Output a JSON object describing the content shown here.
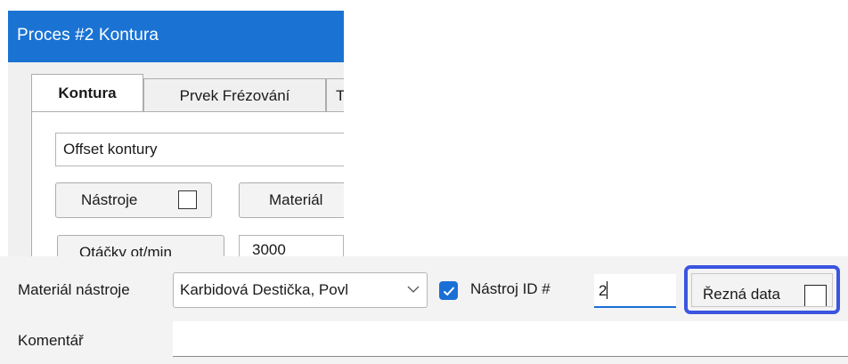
{
  "dialog": {
    "title": "Proces #2 Kontura",
    "tabs": [
      {
        "label": "Kontura",
        "active": true
      },
      {
        "label": "Prvek Frézování",
        "active": false
      },
      {
        "label": "T",
        "active": false
      }
    ],
    "operation_field": "Offset kontury",
    "tools_button": "Nástroje",
    "material_button": "Materiál",
    "rpm_button": "Otáčky ot/min",
    "rpm_value": "3000"
  },
  "strip": {
    "tool_material_label": "Materiál nástroje",
    "tool_material_value": "Karbidová Destička, Povl",
    "tool_id_checked": true,
    "tool_id_label": "Nástroj ID #",
    "tool_id_value": "2",
    "cutting_data_label": "Řezná data",
    "cutting_data_checked": false,
    "comment_label": "Komentář",
    "comment_value": ""
  },
  "colors": {
    "title_bar": "#1a73d3",
    "accent": "#1a6fd6",
    "highlight_box": "#3b55e0"
  },
  "icons": {
    "dropdown": "chevron-down-icon",
    "check": "checkmark-icon"
  }
}
